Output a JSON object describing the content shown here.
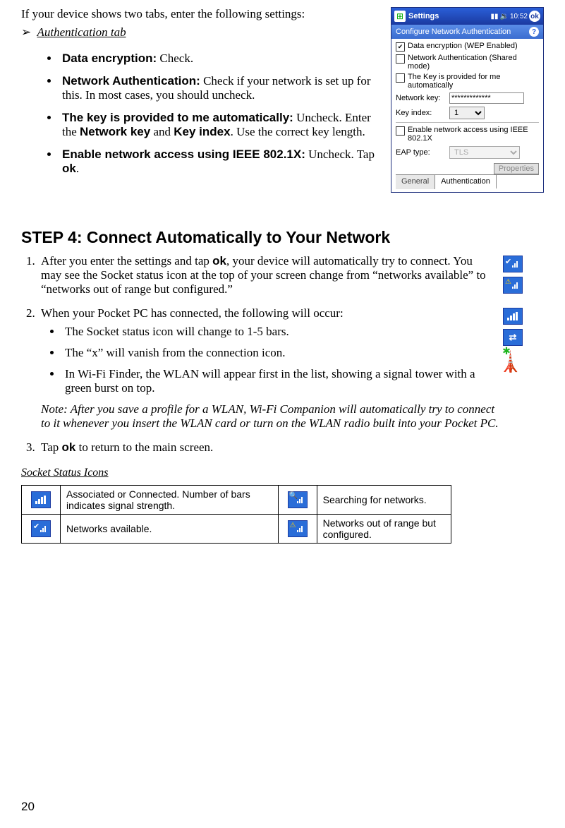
{
  "intro": "If your device shows two tabs, enter the following settings:",
  "auth_tab": "Authentication tab",
  "bullets": {
    "b1_label": "Data encryption:",
    "b1_text": " Check.",
    "b2_label": "Network Authentication:",
    "b2_text": " Check if your network is set up for this. In most cases, you should uncheck.",
    "b3_label": "The key is provided to me automatically:",
    "b3_text_a": " Uncheck. Enter the ",
    "b3_text_b": "Network key",
    "b3_text_c": " and ",
    "b3_text_d": "Key index",
    "b3_text_e": ". Use the correct key length.",
    "b4_label": "Enable network access using IEEE 802.1X:",
    "b4_text_a": " Uncheck. Tap ",
    "b4_text_b": "ok",
    "b4_text_c": "."
  },
  "screenshot": {
    "top_title": "Settings",
    "time": "10:52",
    "ok": "ok",
    "sub_title": "Configure Network Authentication",
    "cb1": "Data encryption (WEP Enabled)",
    "cb1_checked": true,
    "cb2": "Network Authentication (Shared mode)",
    "cb2_checked": false,
    "cb3": "The Key is provided for me automatically",
    "cb3_checked": false,
    "nk_label": "Network key:",
    "nk_value": "*************",
    "ki_label": "Key index:",
    "ki_value": "1",
    "cb4": "Enable network access using IEEE 802.1X",
    "cb4_checked": false,
    "eap_label": "EAP type:",
    "eap_value": "TLS",
    "props": "Properties",
    "tab1": "General",
    "tab2": "Authentication"
  },
  "step4_heading": "STEP 4: Connect Automatically to Your Network",
  "step4": {
    "li1_a": "After you enter the settings and tap ",
    "li1_b": "ok",
    "li1_c": ", your device will automatically try to connect. You may see the Socket status icon at the top of your screen change from “networks available” to “networks out of range but configured.”",
    "li2": "When your Pocket PC has connected, the following will occur:",
    "li2_b1": "The Socket status icon will change to 1-5 bars.",
    "li2_b2": "The “x” will vanish from the connection icon.",
    "li2_b3": "In Wi-Fi Finder, the WLAN will appear first in the list, showing a signal tower with a green burst on top.",
    "note": "Note: After you save a profile for a WLAN, Wi-Fi Companion will automatically try to connect to it whenever you insert the WLAN card or turn on the WLAN radio built into your Pocket PC.",
    "li3_a": "Tap ",
    "li3_b": "ok",
    "li3_c": " to return to the main screen."
  },
  "icons_heading": "Socket Status Icons",
  "icons_table": {
    "r1c1": "Associated or Connected. Number of bars indicates signal strength.",
    "r1c2": "Searching for networks.",
    "r2c1": "Networks available.",
    "r2c2": "Networks out of range but configured."
  },
  "page_number": "20"
}
